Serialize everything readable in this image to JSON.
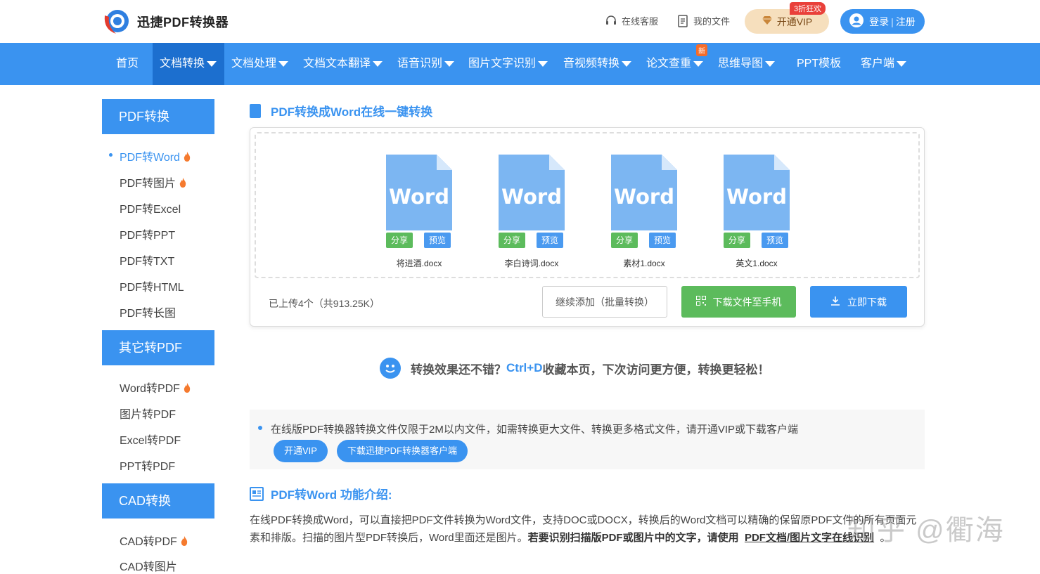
{
  "header": {
    "logo_text": "迅捷PDF转换器",
    "service": "在线客服",
    "my_files": "我的文件",
    "vip_label": "开通VIP",
    "vip_badge": "3折狂欢",
    "login": "登录",
    "register": "注册",
    "login_separator": "|"
  },
  "nav": {
    "items": [
      {
        "label": "首页"
      },
      {
        "label": "文档转换"
      },
      {
        "label": "文档处理"
      },
      {
        "label": "文档文本翻译"
      },
      {
        "label": "语音识别"
      },
      {
        "label": "图片文字识别"
      },
      {
        "label": "音视频转换"
      },
      {
        "label": "论文查重"
      },
      {
        "label": "思维导图"
      },
      {
        "label": "PPT模板"
      },
      {
        "label": "客户端"
      }
    ],
    "new_badge": "新"
  },
  "sidebar": {
    "groups": [
      {
        "title": "PDF转换",
        "items": [
          "PDF转Word",
          "PDF转图片",
          "PDF转Excel",
          "PDF转PPT",
          "PDF转TXT",
          "PDF转HTML",
          "PDF转长图"
        ]
      },
      {
        "title": "其它转PDF",
        "items": [
          "Word转PDF",
          "图片转PDF",
          "Excel转PDF",
          "PPT转PDF"
        ]
      },
      {
        "title": "CAD转换",
        "items": [
          "CAD转PDF",
          "CAD转图片"
        ]
      }
    ]
  },
  "main": {
    "title": "PDF转换成Word在线一键转换",
    "files": [
      {
        "icon_text": "Word",
        "name": "将进酒.docx",
        "share": "分享",
        "preview": "预览"
      },
      {
        "icon_text": "Word",
        "name": "李白诗词.docx",
        "share": "分享",
        "preview": "预览"
      },
      {
        "icon_text": "Word",
        "name": "素材1.docx",
        "share": "分享",
        "preview": "预览"
      },
      {
        "icon_text": "Word",
        "name": "英文1.docx",
        "share": "分享",
        "preview": "预览"
      }
    ],
    "upload_count": "已上传4个（共913.25K）",
    "add_more": "继续添加（批量转换）",
    "download_phone": "下载文件至手机",
    "download_now": "立即下载"
  },
  "tip": {
    "part1": "转换效果还不错？",
    "hotkey": "Ctrl+D",
    "part2": "收藏本页，下次访问更方便，转换更轻松！"
  },
  "notice": {
    "text": "在线版PDF转换器转换文件仅限于2M以内文件，如需转换更大文件、转换更多格式文件，请开通VIP或下载客户端",
    "vip_btn": "开通VIP",
    "client_btn": "下载迅捷PDF转换器客户端"
  },
  "intro": {
    "title": "PDF转Word 功能介绍:",
    "text1": "在线PDF转换成Word，可以直接把PDF文件转换为Word文件，支持DOC或DOCX，转换后的Word文档可以精确的保留原PDF文件的所有页面元素和排版。扫描的图片型PDF转换后，Word里面还是图片。",
    "text_bold": "若要识别扫描版PDF或图片中的文字，请使用",
    "link": "PDF文档/图片文字在线识别",
    "end": "。"
  },
  "watermark": "知乎 @衢海",
  "colors": {
    "primary": "#3a93f0",
    "active_nav": "#1c6fcf",
    "green": "#5cbb5c",
    "vip_bg": "#f6dfbd",
    "badge_red": "#e9403a"
  }
}
